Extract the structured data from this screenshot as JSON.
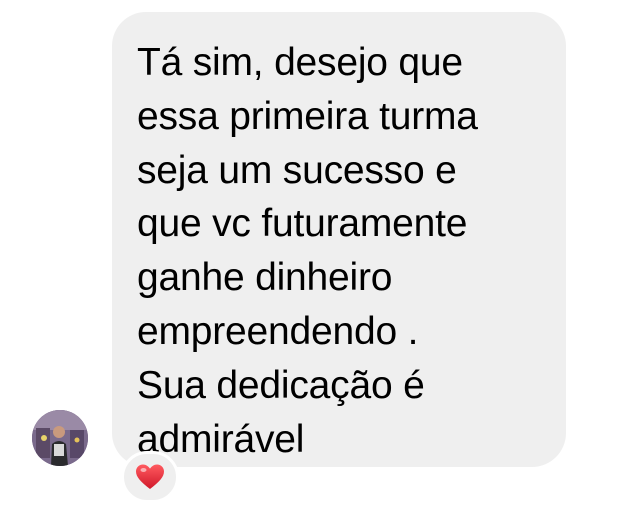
{
  "message": {
    "lines": [
      "Tá sim, desejo que",
      "essa primeira turma",
      "seja um sucesso e",
      "que vc futuramente",
      "ganhe dinheiro",
      "empreendendo .",
      "Sua dedicação é",
      "admirável"
    ]
  },
  "reaction": {
    "icon": "heart-icon",
    "color": "#e0202f"
  },
  "colors": {
    "bubble": "#efefef",
    "text": "#000000",
    "background": "#ffffff"
  }
}
